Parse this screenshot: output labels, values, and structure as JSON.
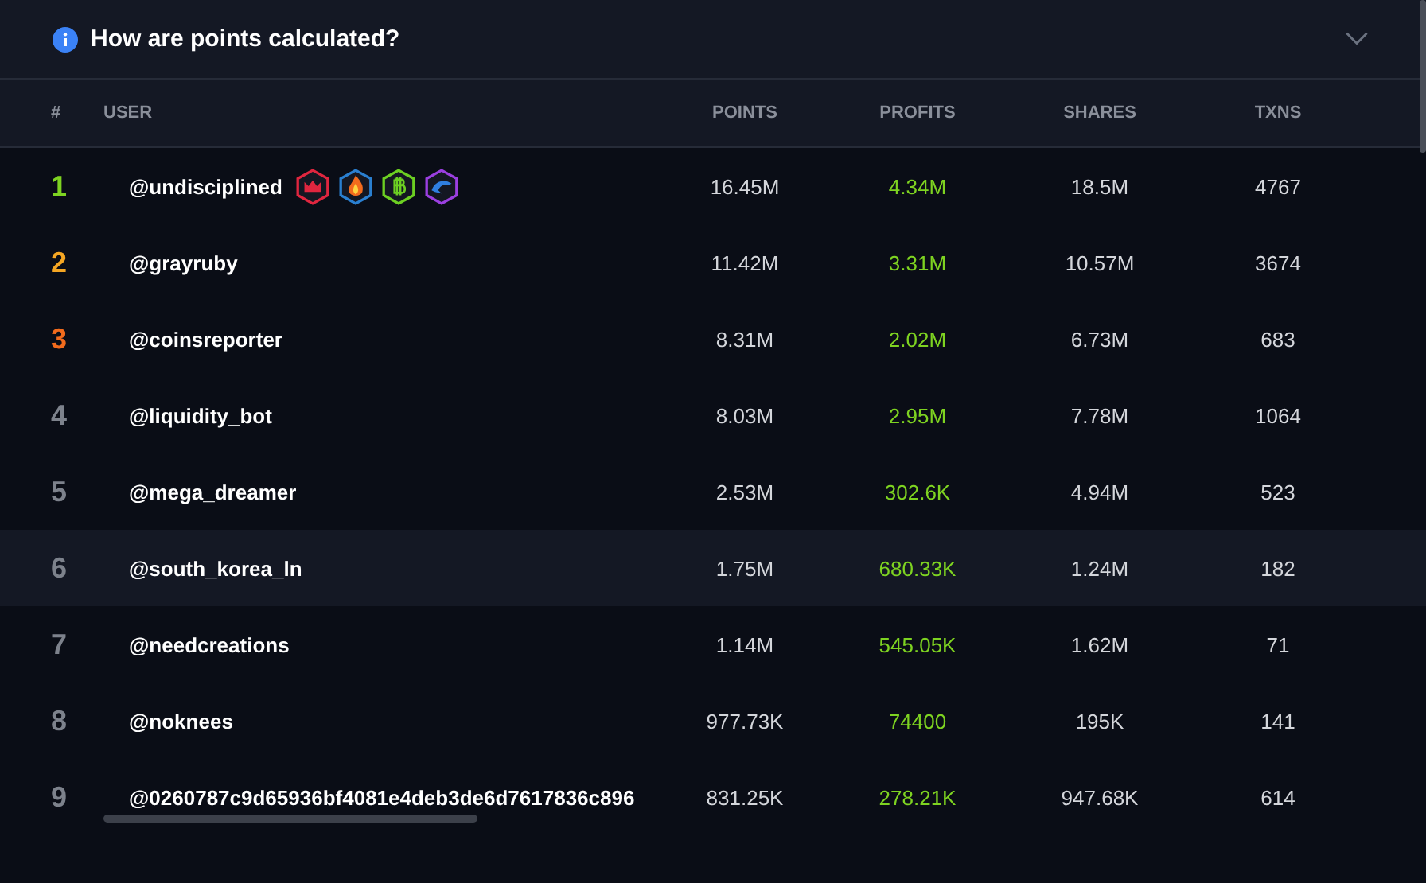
{
  "header": {
    "title": "How are points calculated?",
    "expanded": false
  },
  "table": {
    "columns": [
      "#",
      "USER",
      "POINTS",
      "PROFITS",
      "SHARES",
      "TXNS"
    ],
    "rows": [
      {
        "rank": "1",
        "color": "#7ed321",
        "user": "@undisciplined",
        "badges": [
          {
            "kind": "crown",
            "color": "#e0263f"
          },
          {
            "kind": "flame",
            "color": "#2a7fd0"
          },
          {
            "kind": "bitcoin",
            "color": "#6ccf22"
          },
          {
            "kind": "dolphin",
            "color": "#9b3fe0"
          }
        ],
        "points": "16.45M",
        "profits": "4.34M",
        "shares": "18.5M",
        "txns": "4767",
        "selected": false
      },
      {
        "rank": "2",
        "color": "#f5a623",
        "user": "@grayruby",
        "points": "11.42M",
        "profits": "3.31M",
        "shares": "10.57M",
        "txns": "3674",
        "selected": false
      },
      {
        "rank": "3",
        "color": "#f26b1d",
        "user": "@coinsreporter",
        "points": "8.31M",
        "profits": "2.02M",
        "shares": "6.73M",
        "txns": "683",
        "selected": false
      },
      {
        "rank": "4",
        "color": "#7d828c",
        "user": "@liquidity_bot",
        "points": "8.03M",
        "profits": "2.95M",
        "shares": "7.78M",
        "txns": "1064",
        "selected": false
      },
      {
        "rank": "5",
        "color": "#7d828c",
        "user": "@mega_dreamer",
        "points": "2.53M",
        "profits": "302.6K",
        "shares": "4.94M",
        "txns": "523",
        "selected": false
      },
      {
        "rank": "6",
        "color": "#7d828c",
        "user": "@south_korea_ln",
        "points": "1.75M",
        "profits": "680.33K",
        "shares": "1.24M",
        "txns": "182",
        "selected": true
      },
      {
        "rank": "7",
        "color": "#7d828c",
        "user": "@needcreations",
        "points": "1.14M",
        "profits": "545.05K",
        "shares": "1.62M",
        "txns": "71",
        "selected": false
      },
      {
        "rank": "8",
        "color": "#7d828c",
        "user": "@noknees",
        "points": "977.73K",
        "profits": "74400",
        "shares": "195K",
        "txns": "141",
        "selected": false
      },
      {
        "rank": "9",
        "color": "#7d828c",
        "user": "@0260787c9d65936bf4081e4deb3de6d7617836c896",
        "points": "831.25K",
        "profits": "278.21K",
        "shares": "947.68K",
        "txns": "614",
        "selected": false
      }
    ]
  }
}
